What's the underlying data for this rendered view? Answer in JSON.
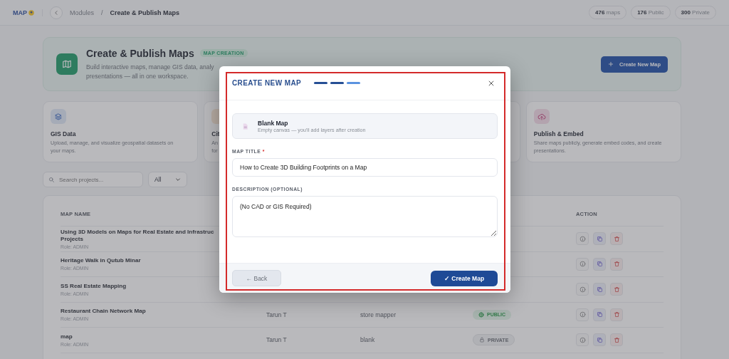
{
  "topbar": {
    "logo": "MAP",
    "breadcrumb": [
      "Modules",
      "Create & Publish Maps"
    ],
    "separator": "/",
    "stats": [
      {
        "number": "476",
        "label": "maps"
      },
      {
        "number": "176",
        "label": "Public"
      },
      {
        "number": "300",
        "label": "Private"
      }
    ]
  },
  "hero": {
    "title": "Create & Publish Maps",
    "badge": "MAP CREATION",
    "description": "Build interactive maps, manage GIS data, analy\npresentations — all in one workspace.",
    "button": "Create New Map"
  },
  "cards": [
    {
      "kind": "layers",
      "title": "GIS Data",
      "description": "Upload, manage, and visualize geospatial datasets on\nyour maps."
    },
    {
      "kind": "pencil",
      "title": "Cit",
      "description": "An\nfor"
    },
    {
      "kind": "hidden"
    },
    {
      "kind": "cloud",
      "title": "Publish & Embed",
      "description": "Share maps publicly, generate embed codes, and create\npresentations."
    }
  ],
  "search": {
    "placeholder": "Search projects..."
  },
  "filter": {
    "value": "All"
  },
  "table": {
    "columns": [
      "MAP NAME",
      "",
      "",
      "",
      "ACTION"
    ],
    "rows": [
      {
        "name": "Using 3D Models on Maps for Real Estate and Infrastruc\nProjects",
        "role": "Role: ADMIN"
      },
      {
        "name": "Heritage Walk in Qutub Minar",
        "role": "Role: ADMIN"
      },
      {
        "name": "SS Real Estate Mapping",
        "role": "Role: ADMIN"
      },
      {
        "name": "Restaurant Chain Network Map",
        "role": "Role: ADMIN",
        "owner": "Tarun T",
        "category": "store mapper",
        "status": {
          "kind": "public",
          "label": "PUBLIC"
        }
      },
      {
        "name": "map",
        "role": "Role: ADMIN",
        "owner": "Tarun T",
        "category": "blank",
        "status": {
          "kind": "private",
          "label": "PRIVATE"
        }
      }
    ]
  },
  "modal": {
    "title": "CREATE NEW MAP",
    "steps": [
      {
        "completed": true
      },
      {
        "completed": true
      },
      {
        "completed": false
      }
    ],
    "option": {
      "title": "Blank Map",
      "subtitle": "Empty canvas — you'll add layers after creation"
    },
    "title_label": "MAP TITLE",
    "required_mark": "*",
    "title_value": "How to Create 3D Building Footprints on a Map",
    "description_label": "DESCRIPTION (OPTIONAL)",
    "description_value": "(No CAD or GIS Required)",
    "back": "← Back",
    "submit": "✓ Create Map"
  }
}
